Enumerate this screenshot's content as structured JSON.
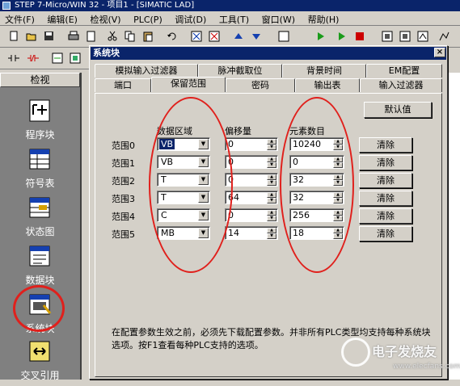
{
  "window": {
    "title": "STEP 7-Micro/WIN 32 - 项目1 - [SIMATIC LAD]"
  },
  "menu": [
    "文件(F)",
    "编辑(E)",
    "检视(V)",
    "PLC(P)",
    "调试(D)",
    "工具(T)",
    "窗口(W)",
    "帮助(H)"
  ],
  "nav": {
    "header": "检视",
    "items": [
      {
        "label": "程序块",
        "icon": "program-block-icon"
      },
      {
        "label": "符号表",
        "icon": "symbol-table-icon"
      },
      {
        "label": "状态图",
        "icon": "status-chart-icon"
      },
      {
        "label": "数据块",
        "icon": "data-block-icon"
      },
      {
        "label": "系统块",
        "icon": "system-block-icon"
      },
      {
        "label": "交叉引用",
        "icon": "cross-reference-icon"
      }
    ]
  },
  "dialog": {
    "title": "系统块",
    "tabs_back": [
      "模拟输入过滤器",
      "脉冲截取位",
      "背景时间",
      "EM配置"
    ],
    "tabs_front": [
      "端口",
      "保留范围",
      "密码",
      "输出表",
      "输入过滤器"
    ],
    "active_tab": "保留范围",
    "default_button": "默认值",
    "headers": {
      "area": "数据区域",
      "offset": "偏移量",
      "count": "元素数目"
    },
    "rows": [
      {
        "label": "范围0",
        "area": "VB",
        "offset": "0",
        "count": "10240",
        "clear": "清除"
      },
      {
        "label": "范围1",
        "area": "VB",
        "offset": "0",
        "count": "0",
        "clear": "清除"
      },
      {
        "label": "范围2",
        "area": "T",
        "offset": "0",
        "count": "32",
        "clear": "清除"
      },
      {
        "label": "范围3",
        "area": "T",
        "offset": "64",
        "count": "32",
        "clear": "清除"
      },
      {
        "label": "范围4",
        "area": "C",
        "offset": "0",
        "count": "256",
        "clear": "清除"
      },
      {
        "label": "范围5",
        "area": "MB",
        "offset": "14",
        "count": "18",
        "clear": "清除"
      }
    ],
    "note": "在配置参数生效之前，必须先下载配置参数。并非所有PLC类型均支持每种系统块选项。按F1查看每种PLC支持的选项。"
  },
  "watermark": {
    "title": "电子发烧友",
    "url": "www.elecfans.com"
  },
  "colors": {
    "title_bar": "#0a246a",
    "dialog_bg": "#d4d0c8",
    "highlight": "#e0201c",
    "nav_bg": "#808080"
  }
}
